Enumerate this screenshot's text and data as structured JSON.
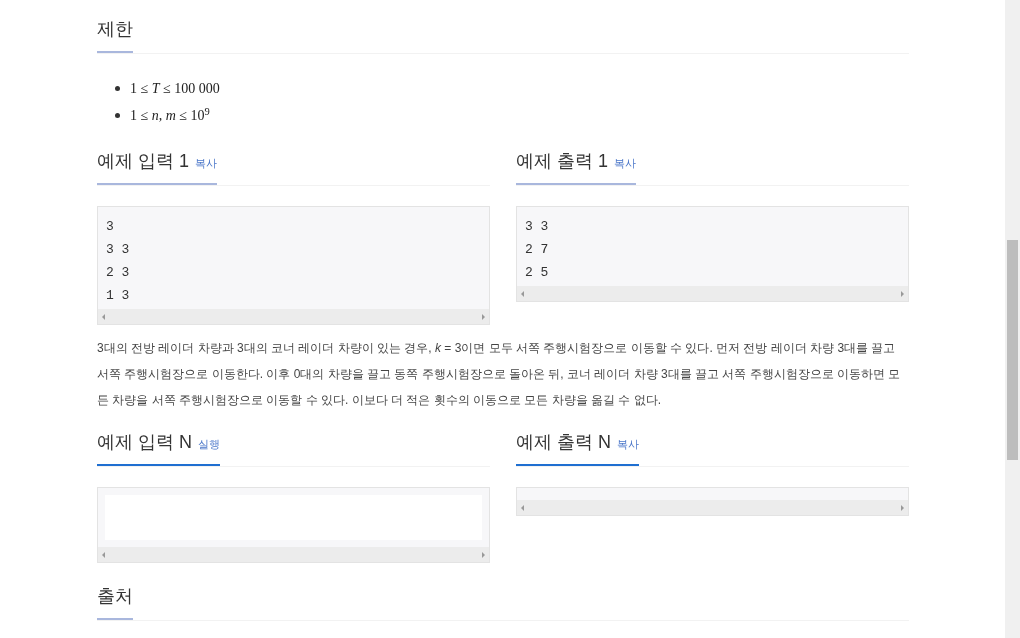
{
  "constraints": {
    "title": "제한",
    "items": [
      "1 ≤ *T* ≤ 100 000",
      "1 ≤ *n*, *m* ≤ 10$^{9}$"
    ]
  },
  "sample_rows": [
    {
      "kind": "sample",
      "blocks": [
        {
          "title": "예제 입력 1",
          "action": "복사",
          "lines": [
            "3",
            "3 3",
            "2 3",
            "1 3"
          ]
        },
        {
          "title": "예제 출력 1",
          "action": "복사",
          "lines": [
            "3 3",
            "2 7",
            "2 5"
          ]
        }
      ]
    },
    {
      "kind": "custom",
      "blocks": [
        {
          "title": "예제 입력 N",
          "action": "실행",
          "editable": true
        },
        {
          "title": "예제 출력 N",
          "action": "복사",
          "editable": false
        }
      ]
    }
  ],
  "explanation": "3대의 전방 레이더 차량과 3대의 코너 레이더 차량이 있는 경우, *k* = 3이면 모두 서쪽 주행시험장으로 이동할 수 있다. 먼저 전방 레이더 차량 3대를 끌고 서쪽 주행시험장으로 이동한다. 이후 0대의 차량을 끌고 동쪽 주행시험장으로 돌아온 뒤, 코너 레이더 차량 3대를 끌고 서쪽 주행시험장으로 이동하면 모든 차량을 서쪽 주행시험장으로 이동할 수 있다. 이보다 더 적은 횟수의 이동으로 모든 차량을 옮길 수 없다.",
  "source": {
    "title": "출처"
  }
}
